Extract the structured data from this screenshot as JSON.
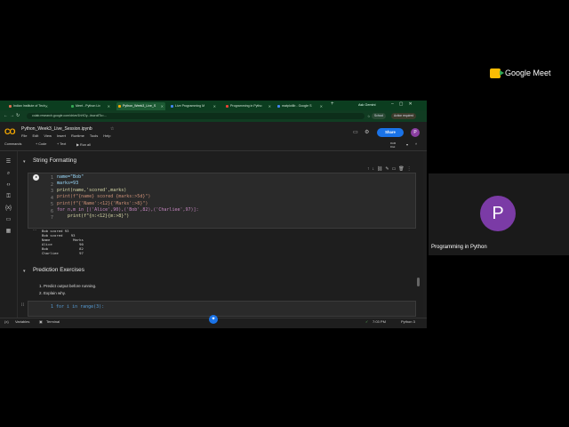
{
  "meet": {
    "brand": "Google Meet",
    "participant_initial": "P",
    "participant_name": "Programming in Python"
  },
  "browser": {
    "tabs": [
      {
        "label": "Indian Institute of Tech",
        "color": "#e06c4f"
      },
      {
        "label": "Meet - Python Liv",
        "color": "#34a853"
      },
      {
        "label": "Python_Week3_Live_S",
        "color": "#f9ab00",
        "active": true
      },
      {
        "label": "Live Programming M",
        "color": "#4285f4"
      },
      {
        "label": "Programming in Pytho",
        "color": "#ea4335"
      },
      {
        "label": "matplotlib - Google S",
        "color": "#4285f4"
      }
    ],
    "url": "colab.research.google.com/drive/1hHOy...#scrollTo=...",
    "ask_gemini": "Ask Gemini",
    "profile_label": "School",
    "action_required": "Action required"
  },
  "colab": {
    "logo": "CO",
    "notebook_title": "Python_Week3_Live_Session.ipynb",
    "menus": [
      "File",
      "Edit",
      "View",
      "Insert",
      "Runtime",
      "Tools",
      "Help"
    ],
    "share_label": "Share",
    "user_initial": "P",
    "toolbar": {
      "commands": "Commands",
      "code": "+ Code",
      "text": "+ Text",
      "run_all": "▶ Run all",
      "ram": "RAM",
      "disk": "Disk"
    },
    "section1_title": "String Formatting",
    "section2_title": "Prediction Exercises",
    "code_lines": [
      "name=\"Bob\"",
      "marks=93",
      "print(name,'scored',marks)",
      "print(f\"{name} scored {marks:>5d}\")",
      "print(f\"{'Name':<12}{'Marks':>8}\")",
      "for n,m in [('Alice',90),('Bob',82),('Charliee',97)]:",
      "    print(f\"{n:<12}{m:>8}\")"
    ],
    "line_numbers": [
      "1",
      "2",
      "3",
      "4",
      "5",
      "6",
      "7"
    ],
    "output_lines": [
      "Bob scored 93",
      "Bob scored    93",
      "Name           Marks",
      "Alice             90",
      "Bob               82",
      "Charliee          97"
    ],
    "exercise_items": [
      "1. Predict output before running.",
      "2. Explain why."
    ],
    "cell2_exec": "[ ]",
    "cell2_code": "1 for i in range(3):",
    "statusbar": {
      "variables": "Variables",
      "terminal": "Terminal",
      "check": "✓",
      "time": "7:03 PM",
      "runtime": "Python 3"
    }
  }
}
